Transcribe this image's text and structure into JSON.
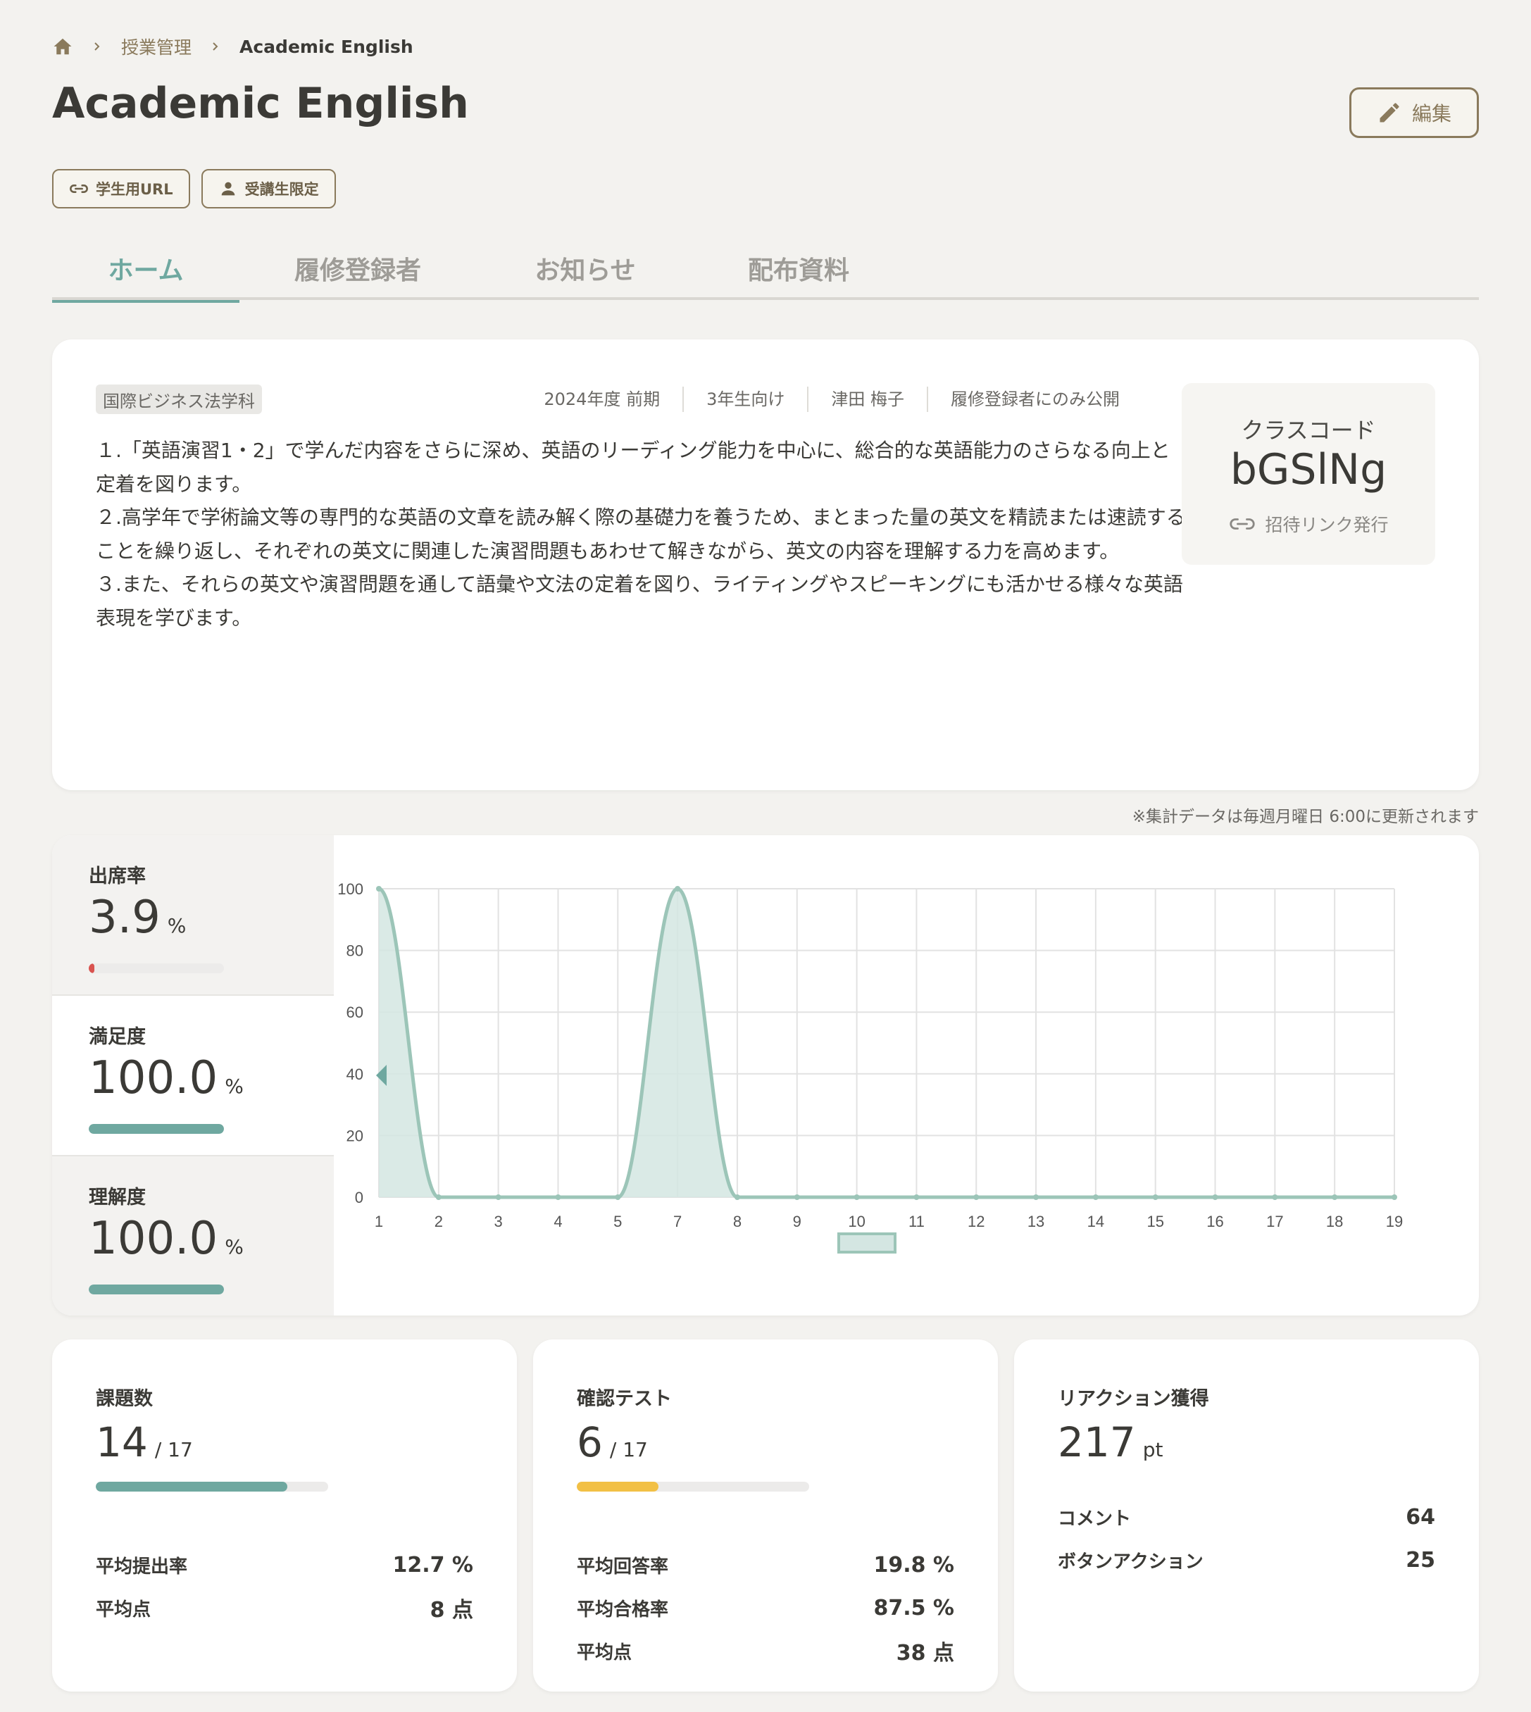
{
  "breadcrumb": {
    "home_icon": "home-icon",
    "items": [
      "授業管理",
      "Academic English"
    ]
  },
  "title": "Academic English",
  "edit_button": {
    "label": "編集",
    "icon": "pencil-icon"
  },
  "tags": [
    {
      "label": "学生用URL",
      "icon": "link-icon"
    },
    {
      "label": "受講生限定",
      "icon": "person-icon"
    }
  ],
  "tabs": [
    {
      "label": "ホーム",
      "active": true
    },
    {
      "label": "履修登録者",
      "active": false
    },
    {
      "label": "お知らせ",
      "active": false
    },
    {
      "label": "配布資料",
      "active": false
    }
  ],
  "course": {
    "department": "国際ビジネス法学科",
    "meta": [
      "2024年度 前期",
      "3年生向け",
      "津田 梅子",
      "履修登録者にのみ公開"
    ],
    "description": [
      "１.「英語演習1・2」で学んだ内容をさらに深め、英語のリーディング能力を中心に、総合的な英語能力のさらなる向上と定着を図ります。",
      "２.高学年で学術論文等の専門的な英語の文章を読み解く際の基礎力を養うため、まとまった量の英文を精読または速読することを繰り返し、それぞれの英文に関連した演習問題もあわせて解きながら、英文の内容を理解する力を高めます。",
      "３.また、それらの英文や演習問題を通して語彙や文法の定着を図り、ライティングやスピーキングにも活かせる様々な英語表現を学びます。"
    ],
    "class_code": {
      "label": "クラスコード",
      "value": "bGSlNg",
      "invite_label": "招待リンク発行"
    }
  },
  "notice": "※集計データは毎週月曜日 6:00に更新されます",
  "metrics": [
    {
      "label": "出席率",
      "value": "3.9",
      "unit": "%",
      "level": 3.9,
      "color": "#d9534f",
      "active": false
    },
    {
      "label": "満足度",
      "value": "100.0",
      "unit": "%",
      "level": 100,
      "color": "#6fa8a0",
      "active": true
    },
    {
      "label": "理解度",
      "value": "100.0",
      "unit": "%",
      "level": 100,
      "color": "#6fa8a0",
      "active": false
    }
  ],
  "chart_data": {
    "type": "area",
    "x": [
      "1",
      "2",
      "3",
      "4",
      "5",
      "7",
      "8",
      "9",
      "10",
      "11",
      "12",
      "13",
      "14",
      "15",
      "16",
      "17",
      "18",
      "19"
    ],
    "series": [
      {
        "values": [
          100,
          0,
          0,
          0,
          0,
          100,
          0,
          0,
          0,
          0,
          0,
          0,
          0,
          0,
          0,
          0,
          0,
          0
        ]
      }
    ],
    "yticks": [
      "0",
      "20",
      "40",
      "60",
      "80",
      "100"
    ],
    "ylim": [
      0,
      100
    ],
    "grid": true,
    "legend": "bottom-center",
    "line_color": "#9cc5b8",
    "fill_color": "#d4e6e2"
  },
  "cards": {
    "assignments": {
      "title": "課題数",
      "value": "14",
      "total": "/ 17",
      "progress": 0.8235,
      "color": "#6fa8a0",
      "rows": [
        {
          "label": "平均提出率",
          "value": "12.7 %"
        },
        {
          "label": "平均点",
          "value": "8 点"
        }
      ]
    },
    "tests": {
      "title": "確認テスト",
      "value": "6",
      "total": "/ 17",
      "progress": 0.353,
      "color": "#f2c045",
      "rows": [
        {
          "label": "平均回答率",
          "value": "19.8 %"
        },
        {
          "label": "平均合格率",
          "value": "87.5 %"
        },
        {
          "label": "平均点",
          "value": "38 点"
        }
      ]
    },
    "reactions": {
      "title": "リアクション獲得",
      "value": "217",
      "unit": "pt",
      "rows": [
        {
          "label": "コメント",
          "value": "64"
        },
        {
          "label": "ボタンアクション",
          "value": "25"
        }
      ]
    }
  }
}
